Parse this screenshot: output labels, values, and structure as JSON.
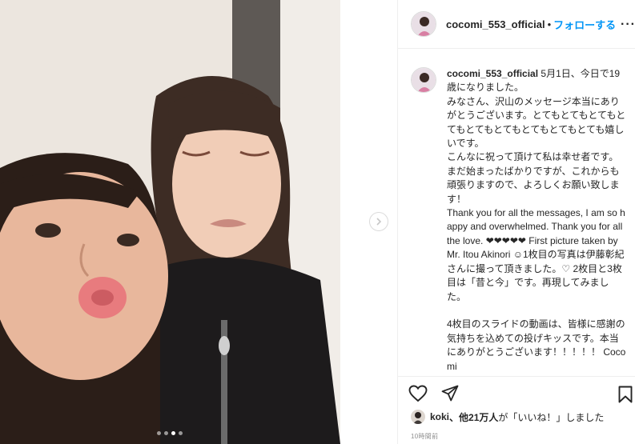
{
  "post": {
    "username": "cocomi_553_official",
    "separator": "•",
    "follow_label": "フォローする",
    "more_icon": "more-options-icon",
    "more_glyph": "···",
    "caption_username": "cocomi_553_official",
    "caption": " 5月1日、今日で19歳になりました。\nみなさん、沢山のメッセージ本当にありがとうございます。とてもとてもとてもとてもとてもとてもとてもとてもとても嬉しいです。\nこんなに祝って頂けて私は幸せ者です。まだ始まったばかりですが、これからも頑張りますので、よろしくお願い致します！\nThank you for all the messages, I am so happy and overwhelmed. Thank you for all the love. ❤❤❤❤❤ First picture taken by Mr. Itou Akinori ☺1枚目の写真は伊藤彰紀さんに撮って頂きました。♡ 2枚目と3枚目は「昔と今」です。再現してみました。\n\n4枚目のスライドの動画は、皆様に感謝の気持ちを込めての投げキッスです。本当にありがとうございます！！！！！ Cocomi",
    "likes_user": "koki",
    "likes_rest": "、他21万人",
    "likes_suffix": "が「いいね！」しました",
    "timestamp": "10時間前",
    "carousel": {
      "count": 4,
      "active_index": 2
    }
  },
  "icons": {
    "like": "heart-icon",
    "share": "paper-plane-icon",
    "save": "bookmark-icon",
    "next": "chevron-right-icon"
  },
  "colors": {
    "follow": "#0095f6",
    "text": "#262626",
    "muted": "#8e8e8e",
    "border": "#efefef"
  }
}
